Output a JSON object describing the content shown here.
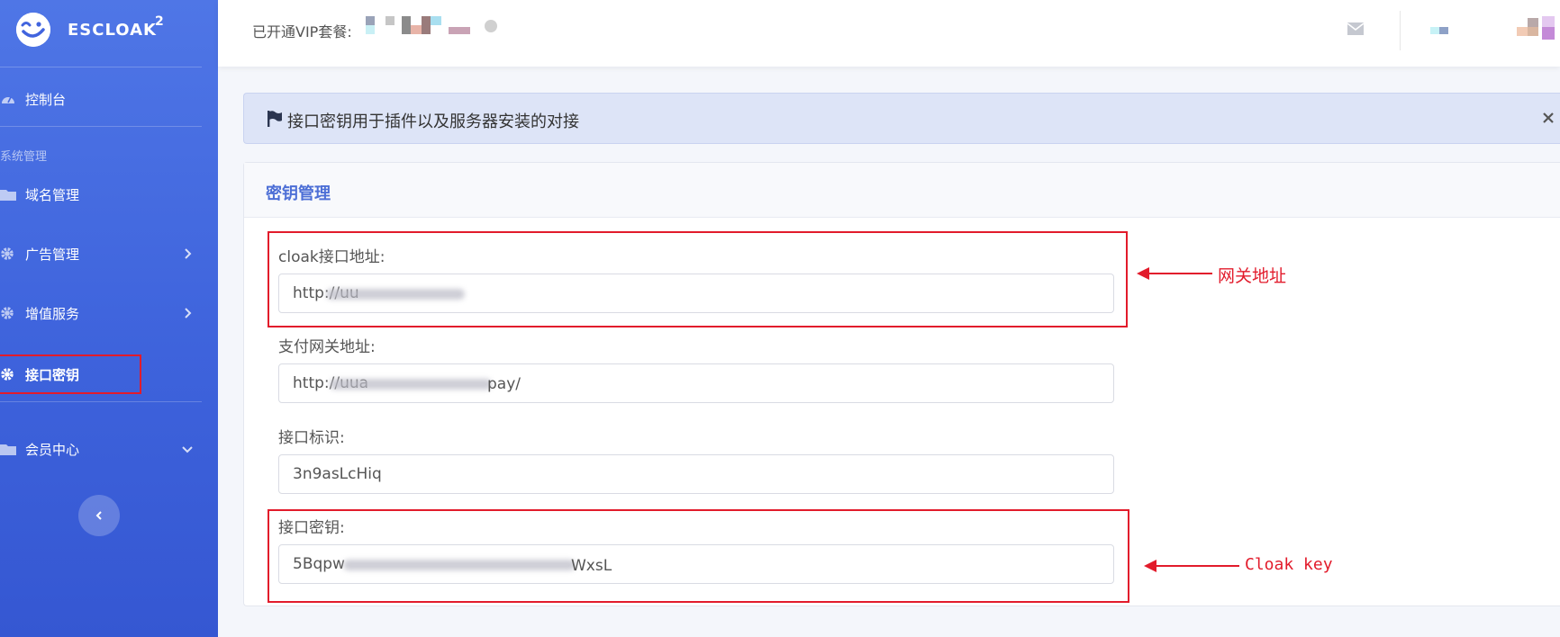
{
  "brand": {
    "name": "ESCLOAK",
    "sup": "2"
  },
  "sidebar": {
    "items": [
      {
        "label": "控制台",
        "icon": "dashboard-icon"
      },
      {
        "label": "域名管理",
        "icon": "folder-icon"
      },
      {
        "label": "广告管理",
        "icon": "gear-icon"
      },
      {
        "label": "增值服务",
        "icon": "gear-icon"
      },
      {
        "label": "接口密钥",
        "icon": "gear-icon",
        "active": true
      },
      {
        "label": "会员中心",
        "icon": "folder-icon"
      }
    ],
    "section_label": "系统管理"
  },
  "topbar": {
    "vip_label": "已开通VIP套餐:"
  },
  "alert": {
    "text": "接口密钥用于插件以及服务器安装的对接"
  },
  "panel": {
    "title": "密钥管理",
    "fields": [
      {
        "label": "cloak接口地址:",
        "value": "http://uu"
      },
      {
        "label": "支付网关地址:",
        "value": "http://uua"
      },
      {
        "label": "接口标识:",
        "value": "3n9asLcHiq"
      },
      {
        "label": "接口密钥:",
        "value": "5Bqpw"
      }
    ],
    "field_tails": [
      "",
      "pay/",
      "",
      "WxsL"
    ]
  },
  "annotations": {
    "gateway": "网关地址",
    "key": "Cloak key"
  },
  "colors": {
    "sidebar": "#4164de",
    "accent": "#4d6fd6",
    "highlight": "#e21b2b",
    "alert_bg": "#dde4f7"
  }
}
